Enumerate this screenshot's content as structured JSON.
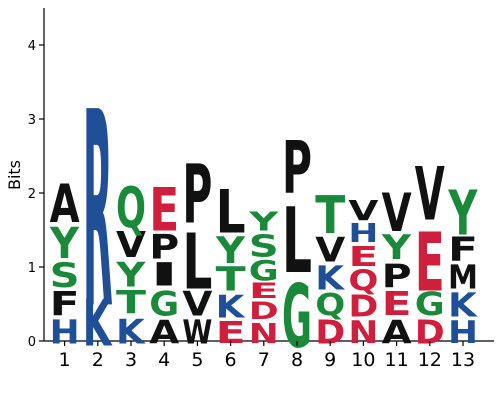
{
  "chart_data": {
    "type": "sequence-logo",
    "ylabel": "Bits",
    "ylim": [
      0,
      4.5
    ],
    "yticks": [
      "0",
      "1",
      "2",
      "3",
      "4"
    ],
    "colors": {
      "green": "#1a8a3a",
      "red": "#cf1f3c",
      "blue": "#1e4f97",
      "black": "#111111"
    },
    "positions": [
      {
        "label": "1",
        "stack": [
          {
            "letter": "H",
            "height": 0.38,
            "color": "blue"
          },
          {
            "letter": "F",
            "height": 0.38,
            "color": "black"
          },
          {
            "letter": "S",
            "height": 0.4,
            "color": "green"
          },
          {
            "letter": "Y",
            "height": 0.5,
            "color": "green"
          },
          {
            "letter": "A",
            "height": 0.62,
            "color": "black"
          }
        ]
      },
      {
        "label": "2",
        "stack": [
          {
            "letter": "K",
            "height": 0.75,
            "color": "blue"
          },
          {
            "letter": "R",
            "height": 3.15,
            "color": "blue"
          }
        ]
      },
      {
        "label": "3",
        "stack": [
          {
            "letter": "K",
            "height": 0.4,
            "color": "blue"
          },
          {
            "letter": "T",
            "height": 0.37,
            "color": "green"
          },
          {
            "letter": "Y",
            "height": 0.4,
            "color": "green"
          },
          {
            "letter": "V",
            "height": 0.42,
            "color": "black"
          },
          {
            "letter": "Q",
            "height": 0.66,
            "color": "green"
          }
        ]
      },
      {
        "label": "4",
        "stack": [
          {
            "letter": "A",
            "height": 0.38,
            "color": "black"
          },
          {
            "letter": "G",
            "height": 0.4,
            "color": "green"
          },
          {
            "letter": "I",
            "height": 0.37,
            "color": "black"
          },
          {
            "letter": "P",
            "height": 0.4,
            "color": "black"
          },
          {
            "letter": "E",
            "height": 0.7,
            "color": "red"
          }
        ]
      },
      {
        "label": "5",
        "stack": [
          {
            "letter": "W",
            "height": 0.38,
            "color": "black"
          },
          {
            "letter": "V",
            "height": 0.4,
            "color": "black"
          },
          {
            "letter": "L",
            "height": 0.9,
            "color": "black"
          },
          {
            "letter": "P",
            "height": 0.95,
            "color": "black"
          }
        ]
      },
      {
        "label": "6",
        "stack": [
          {
            "letter": "E",
            "height": 0.35,
            "color": "red"
          },
          {
            "letter": "K",
            "height": 0.36,
            "color": "blue"
          },
          {
            "letter": "T",
            "height": 0.38,
            "color": "green"
          },
          {
            "letter": "Y",
            "height": 0.43,
            "color": "green"
          },
          {
            "letter": "L",
            "height": 0.7,
            "color": "black"
          }
        ]
      },
      {
        "label": "7",
        "stack": [
          {
            "letter": "N",
            "height": 0.32,
            "color": "red"
          },
          {
            "letter": "D",
            "height": 0.28,
            "color": "red"
          },
          {
            "letter": "E",
            "height": 0.25,
            "color": "red"
          },
          {
            "letter": "G",
            "height": 0.32,
            "color": "green"
          },
          {
            "letter": "S",
            "height": 0.35,
            "color": "green"
          },
          {
            "letter": "Y",
            "height": 0.3,
            "color": "green"
          }
        ]
      },
      {
        "label": "8",
        "stack": [
          {
            "letter": "G",
            "height": 1.02,
            "color": "green"
          },
          {
            "letter": "L",
            "height": 1.05,
            "color": "black"
          },
          {
            "letter": "P",
            "height": 0.85,
            "color": "black"
          }
        ]
      },
      {
        "label": "9",
        "stack": [
          {
            "letter": "D",
            "height": 0.38,
            "color": "red"
          },
          {
            "letter": "Q",
            "height": 0.35,
            "color": "green"
          },
          {
            "letter": "K",
            "height": 0.38,
            "color": "blue"
          },
          {
            "letter": "V",
            "height": 0.4,
            "color": "black"
          },
          {
            "letter": "T",
            "height": 0.6,
            "color": "green"
          }
        ]
      },
      {
        "label": "10",
        "stack": [
          {
            "letter": "N",
            "height": 0.36,
            "color": "red"
          },
          {
            "letter": "D",
            "height": 0.35,
            "color": "red"
          },
          {
            "letter": "Q",
            "height": 0.33,
            "color": "red"
          },
          {
            "letter": "E",
            "height": 0.32,
            "color": "red"
          },
          {
            "letter": "H",
            "height": 0.3,
            "color": "blue"
          },
          {
            "letter": "V",
            "height": 0.32,
            "color": "black"
          }
        ]
      },
      {
        "label": "11",
        "stack": [
          {
            "letter": "A",
            "height": 0.38,
            "color": "black"
          },
          {
            "letter": "E",
            "height": 0.38,
            "color": "red"
          },
          {
            "letter": "P",
            "height": 0.38,
            "color": "black"
          },
          {
            "letter": "Y",
            "height": 0.4,
            "color": "green"
          },
          {
            "letter": "V",
            "height": 0.62,
            "color": "black"
          }
        ]
      },
      {
        "label": "12",
        "stack": [
          {
            "letter": "D",
            "height": 0.38,
            "color": "red"
          },
          {
            "letter": "G",
            "height": 0.38,
            "color": "green"
          },
          {
            "letter": "E",
            "height": 0.95,
            "color": "red"
          },
          {
            "letter": "V",
            "height": 0.86,
            "color": "black"
          }
        ]
      },
      {
        "label": "13",
        "stack": [
          {
            "letter": "H",
            "height": 0.36,
            "color": "blue"
          },
          {
            "letter": "K",
            "height": 0.38,
            "color": "blue"
          },
          {
            "letter": "M",
            "height": 0.38,
            "color": "black"
          },
          {
            "letter": "F",
            "height": 0.38,
            "color": "black"
          },
          {
            "letter": "Y",
            "height": 0.72,
            "color": "green"
          }
        ]
      }
    ]
  }
}
